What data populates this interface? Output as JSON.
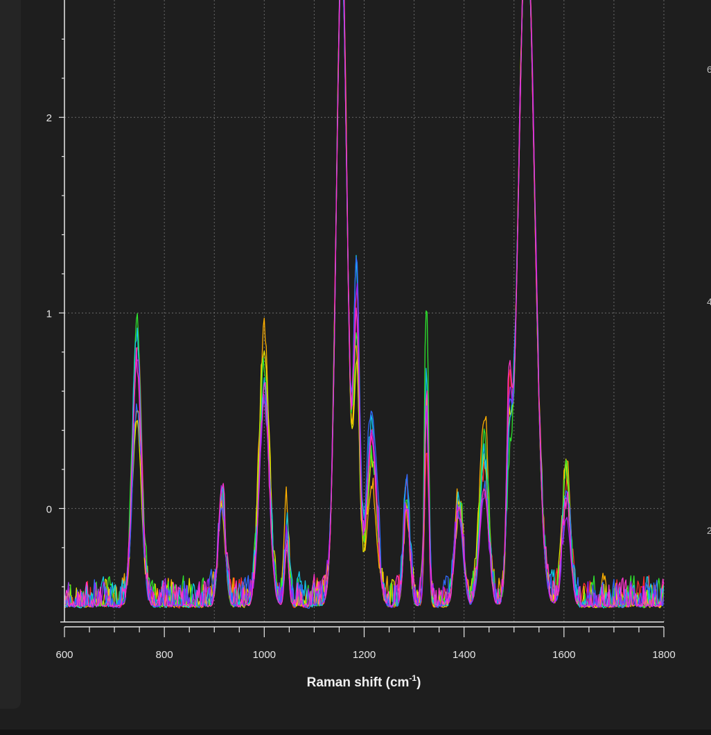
{
  "chart_data": {
    "type": "line",
    "title": "",
    "xlabel": "Raman shift (cm",
    "xlabel_sup": "-1",
    "xlabel_close": ")",
    "ylabel": "",
    "xlim": [
      600,
      1800
    ],
    "ylim": [
      -0.58,
      2.6
    ],
    "x_ticks": [
      600,
      800,
      1000,
      1200,
      1400,
      1600,
      1800
    ],
    "y_ticks": [
      0,
      1,
      2
    ],
    "grid": true,
    "legend": "none",
    "right_edge_labels": [
      "6",
      "4",
      "2"
    ],
    "colors": [
      "#ff2a2a",
      "#ffb000",
      "#e6e600",
      "#2ee62e",
      "#10c8e6",
      "#2f6bff",
      "#a020f0",
      "#ff33cc"
    ],
    "peaks": [
      {
        "center": 745,
        "height": [
          1.3,
          1.0,
          0.95,
          1.45,
          1.35,
          1.0,
          1.25,
          1.2
        ],
        "width": 9
      },
      {
        "center": 915,
        "height": [
          0.55,
          0.45,
          0.5,
          0.5,
          0.55,
          0.5,
          0.5,
          0.6
        ],
        "width": 7
      },
      {
        "center": 1000,
        "height": [
          1.05,
          1.35,
          1.3,
          1.2,
          1.1,
          1.05,
          1.0,
          1.0
        ],
        "width": 10
      },
      {
        "center": 1045,
        "height": [
          0.35,
          0.5,
          0.3,
          0.35,
          0.35,
          0.3,
          0.3,
          0.3
        ],
        "width": 4
      },
      {
        "center": 1155,
        "height": [
          3.3,
          3.3,
          3.3,
          3.3,
          3.3,
          3.3,
          3.3,
          3.3
        ],
        "width": 11
      },
      {
        "center": 1185,
        "height": [
          1.5,
          1.2,
          1.1,
          1.3,
          1.6,
          1.7,
          1.5,
          1.4
        ],
        "width": 6
      },
      {
        "center": 1215,
        "height": [
          0.8,
          0.6,
          0.7,
          0.75,
          0.9,
          1.0,
          0.9,
          0.85
        ],
        "width": 10
      },
      {
        "center": 1285,
        "height": [
          0.55,
          0.45,
          0.5,
          0.55,
          0.65,
          0.6,
          0.5,
          0.5
        ],
        "width": 6
      },
      {
        "center": 1325,
        "height": [
          0.8,
          1.0,
          1.0,
          1.55,
          1.15,
          1.05,
          0.95,
          1.0
        ],
        "width": 4
      },
      {
        "center": 1390,
        "height": [
          0.5,
          0.5,
          0.45,
          0.5,
          0.5,
          0.45,
          0.45,
          0.5
        ],
        "width": 8
      },
      {
        "center": 1440,
        "height": [
          0.65,
          0.95,
          0.75,
          0.85,
          0.7,
          0.6,
          0.55,
          0.6
        ],
        "width": 9
      },
      {
        "center": 1490,
        "height": [
          0.8,
          0.6,
          0.6,
          0.4,
          0.6,
          0.7,
          0.75,
          0.9
        ],
        "width": 5
      },
      {
        "center": 1525,
        "height": [
          3.5,
          3.5,
          3.5,
          3.5,
          3.5,
          3.5,
          3.5,
          3.5
        ],
        "width": 16
      },
      {
        "center": 1605,
        "height": [
          0.6,
          0.75,
          0.65,
          0.7,
          0.55,
          0.5,
          0.45,
          0.5
        ],
        "width": 8
      }
    ],
    "baseline": -0.49,
    "noise": 0.06
  }
}
